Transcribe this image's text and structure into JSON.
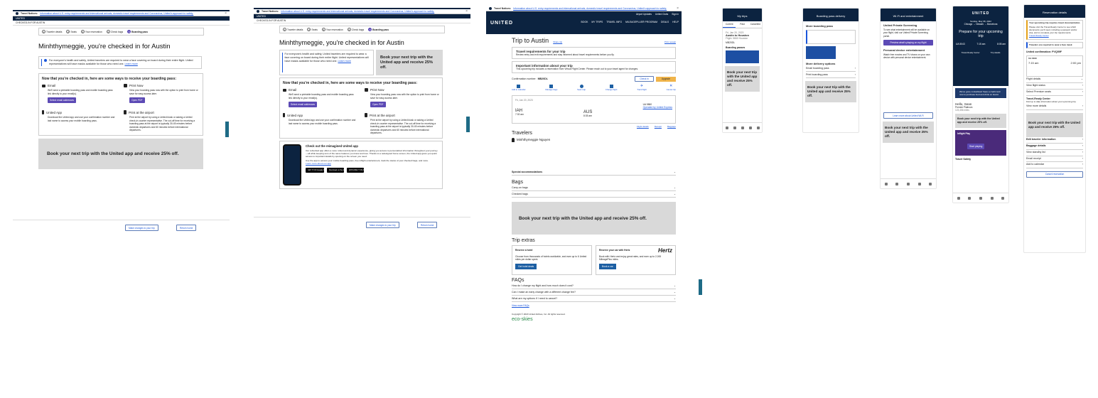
{
  "alert": {
    "title": "Travel Notices:",
    "text": "Information about U.S. entry requirements and international arrivals; domestic travel requirements and Coronavirus, United's approach to safety;",
    "link": "learn more"
  },
  "brand": {
    "logo": "UNITED"
  },
  "panel1": {
    "sub_header": "CHECKED-IN FOR AUSTIN",
    "steps": [
      "Traveler details",
      "Seats",
      "Your reservation",
      "Check bags",
      "Boarding pass"
    ],
    "heading": "Minhthymeggie, you're checked in for Austin",
    "notice": "For everyone's health and safety, United travelers are required to wear a face covering on board during their entire flight. United representatives will have masks available for those who need one.",
    "notice_link": "Learn more",
    "options_title": "Now that you're checked in, here are some ways to receive your boarding pass:",
    "email": {
      "title": "Email",
      "desc": "We'll send a printable boarding pass and mobile boarding pass link directly to your email(s).",
      "button": "Select email addresses"
    },
    "print": {
      "title": "Print Now",
      "desc": "View your boarding pass now with the option to print from home or save for easy access later.",
      "button": "Open PDF"
    },
    "app": {
      "title": "United App",
      "desc": "Download the United app and use your confirmation number and last name to access your mobile boarding pass."
    },
    "airport": {
      "title": "Print at the airport",
      "desc": "Print at the airport by using a United kiosk or asking a United check-in counter representative. The cut-off time for receiving a boarding pass at the airport is typically 30-45 minutes before domestic departures and 60 minutes before international departures."
    },
    "promo": "Book your next trip with the United app and receive 25% off.",
    "btn_changes": "Make changes to your trip",
    "btn_home": "Return home",
    "side_tab": "Feedback"
  },
  "panel2": {
    "sub_header": "CHECKED-IN FOR AUSTIN",
    "heading": "Minhthymeggie, you're checked in for Austin",
    "promo": "Book your next trip with the United app and receive 25% off.",
    "reimagined_title": "Check out the reimagined United app",
    "reimagined_desc": "Our refreshed app offers a more robust and dynamic experience, giving you access to personalized information throughout your journey—all while keeping tons of the same features you know and love. Thanks to a redesigned home screen, the United app gives you quick access to important details by opening on the screen you need.",
    "reimagined_desc2": "Use the app to access your mobile boarding pass, free inflight entertainment, track the status of your checked bags, and more.",
    "reimagined_link": "Learn more about our app",
    "stores": [
      "GET IT ON Google Play",
      "Download on the App Store",
      "EXPLORE IT ON AppGallery"
    ]
  },
  "panel3": {
    "top_nav": [
      "BOOK",
      "MY TRIPS",
      "TRAVEL INFO",
      "MILEAGEPLUS® PROGRAM",
      "DEALS",
      "HELP"
    ],
    "top_links": [
      "Airport Updates",
      "United Clubs",
      "Sign in"
    ],
    "title": "Trip to Austin",
    "title_link": "Share trip",
    "print_link": "Print receipt",
    "notice1_title": "Travel requirements for your trip",
    "notice1_text": "Review entry and exit requirements and stay informed about travel requirements before you fly.",
    "notice2_title": "Important information about your trip",
    "notice2_text": "This upcoming trip includes a reservation from Virtual Flight Center. Please reach out to your travel agent for changes.",
    "confirmation_label": "Confirmation number:",
    "confirmation": "MB20DL",
    "actions": [
      "Check in",
      "Upgrade"
    ],
    "icons": [
      "Add to calendar",
      "Manage bags",
      "Seat map",
      "Change flight",
      "Track flight",
      "Cancel trip"
    ],
    "flight": {
      "date": "Fri, Jan 20, 2023",
      "from": "IAH",
      "to": "AUS",
      "depart": "7:30 am",
      "arrive": "8:35 am",
      "flight_no": "UA 5860",
      "operated": "Operated by United Express"
    },
    "links_row": [
      "Flight details",
      "Receipt",
      "Baggage"
    ],
    "travelers_title": "Travelers",
    "traveler_name": "Minhthymeggie Nguyen",
    "special_title": "Special accommodations",
    "bags_title": "Bags",
    "carry_on": "Carry-on bags",
    "checked": "Checked bags",
    "promo": "Book your next trip with the United app and receive 25% off.",
    "extras_title": "Trip extras",
    "extra1": {
      "title": "Reserve a hotel",
      "desc": "Choose from thousands of hotels worldwide, and earn up to 6 United miles per dollar spent.",
      "button": "Get hotel deals"
    },
    "extra2": {
      "title": "Reserve your car with Hertz",
      "desc": "Book with Hertz and enjoy great rates, and earn up to 2,000 MileagePlus miles.",
      "button": "Book a car"
    },
    "hertz": "Hertz",
    "faq_title": "FAQs",
    "faqs": [
      "How do I change my flight and how much does it cost?",
      "Can I make an early change with a different change fee?",
      "What are my options if I need to cancel?"
    ],
    "faq_link": "View more FAQs",
    "eco": "eco-skies",
    "footer": "Copyright © 2023 United Airlines, Inc. All rights reserved."
  },
  "phone1": {
    "title": "My trips",
    "tabs": [
      "Current",
      "Past",
      "Cancelled"
    ],
    "trip_date": "Fri, Jan 20, 2023",
    "trip_title": "Austin to Houston",
    "trip_sub": "Flight: 5860 Houston",
    "conf": "MB20DL",
    "section": "Boarding passes",
    "promo": "Book your next trip with the United app and receive 25% off."
  },
  "phone2": {
    "title": "Boarding pass delivery",
    "sec1": "More boarding pass",
    "sec2": "More delivery options",
    "items": [
      "Email boarding pass",
      "Print boarding pass"
    ],
    "promo": "Book your next trip with the United app and receive 25% off."
  },
  "phone3": {
    "title": "Wi-Fi and entertainment",
    "h1": "United Private Screening",
    "t1": "To see what entertainment will be available on your flight, visit our United Private Screening portal.",
    "button": "Preview what's playing on my flight",
    "h2": "Personal device entertainment",
    "t2": "Watch free movies and TV shows on your own device with personal device entertainment.",
    "link": "Learn more about United Wi-Fi",
    "promo": "Book your next trip with the United app and receive 25% off."
  },
  "phone4": {
    "logo": "UNITED",
    "date": "Sunday, May 08, 2022",
    "route": "Chicago → Newark → Barcelona",
    "prepare": "Prepare for your upcoming trip",
    "flight": "UA 5043",
    "dep": "7:15 am",
    "arr": "8:05 am",
    "tiles": [
      "Travel-Ready Center",
      "Trip details"
    ],
    "card": "We've gone contactless! Save a credit card now to purchase food and drink on board.",
    "hello": "Hello, Sean",
    "status": "Premier Platinum",
    "miles": "123,456 miles",
    "promo": "Book your next trip with the United app and receive 25% off.",
    "inflight": "Inflight Play",
    "inflight_btn": "Start playing",
    "safety": "Travel Safety"
  },
  "phone5": {
    "title": "Reservation details",
    "warn_title": "Your upcoming trip requires travel documentation.",
    "warn_text": "Please visit the Travel-Ready Center to see which documents you'll need, including a passport and/or visa, and to complete your trip requirements.",
    "warn_link": "Travel-Ready Center",
    "warn2": "Travelers are required to wear a face mask",
    "conf": "United confirmation: PVQ59F",
    "flight": "UA 0043",
    "dep": "7:15 am",
    "arr": "2:00 pm",
    "rows": [
      "Flight details",
      "View flight status",
      "Select Premium seats"
    ],
    "trc": "Travel-Ready Center",
    "trc_sub": "Find up to date information about your upcoming trip.",
    "view": "View more details",
    "promo": "Book your next trip with the United app and receive 25% off.",
    "rows2": [
      "Edit traveler information",
      "Baggage details",
      "View standby list",
      "Email receipt",
      "Add to calendar"
    ],
    "cancel": "Cancel reservation"
  }
}
